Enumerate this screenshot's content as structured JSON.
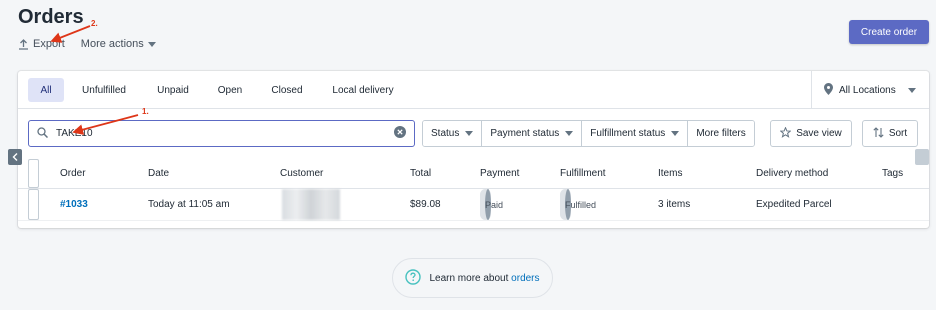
{
  "header": {
    "title": "Orders",
    "export_label": "Export",
    "more_actions_label": "More actions",
    "create_label": "Create order"
  },
  "tabs": [
    {
      "label": "All",
      "active": true
    },
    {
      "label": "Unfulfilled"
    },
    {
      "label": "Unpaid"
    },
    {
      "label": "Open"
    },
    {
      "label": "Closed"
    },
    {
      "label": "Local delivery"
    }
  ],
  "location": {
    "label": "All Locations"
  },
  "search": {
    "value": "TAKE10"
  },
  "filters": {
    "status": "Status",
    "payment": "Payment status",
    "fulfillment": "Fulfillment status",
    "more": "More filters",
    "save_view": "Save view",
    "sort": "Sort"
  },
  "table": {
    "columns": [
      "Order",
      "Date",
      "Customer",
      "Total",
      "Payment",
      "Fulfillment",
      "Items",
      "Delivery method",
      "Tags"
    ],
    "rows": [
      {
        "order": "#1033",
        "date": "Today at 11:05 am",
        "customer": "",
        "total": "$89.08",
        "payment": "Paid",
        "fulfillment": "Fulfilled",
        "items": "3 items",
        "delivery": "Expedited Parcel",
        "tags": ""
      }
    ]
  },
  "learn_more": {
    "prefix": "Learn more about ",
    "link": "orders"
  },
  "annotations": {
    "step1": "1.",
    "step2": "2."
  },
  "colors": {
    "accent": "#5c6ac4",
    "link": "#006fbb",
    "annotation": "#de3618"
  }
}
